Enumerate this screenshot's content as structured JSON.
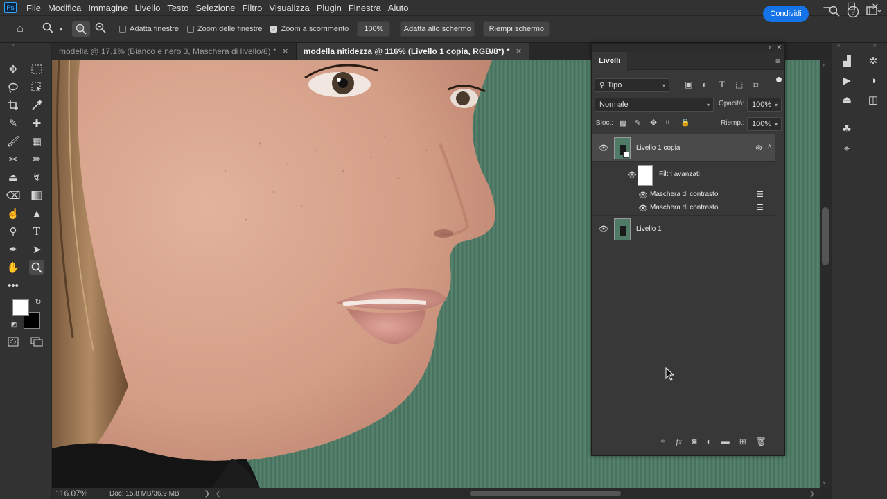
{
  "app": {
    "logo": "Ps"
  },
  "menu": [
    "File",
    "Modifica",
    "Immagine",
    "Livello",
    "Testo",
    "Selezione",
    "Filtro",
    "Visualizza",
    "Plugin",
    "Finestra",
    "Aiuto"
  ],
  "window_controls": {
    "minimize": "—",
    "restore": "❐",
    "close": "✕"
  },
  "options": {
    "fit_windows": "Adatta finestre",
    "zoom_all_windows": "Zoom delle finestre",
    "scrubby_zoom": "Zoom a scorrimento",
    "zoom_value": "100%",
    "fit_screen": "Adatta allo schermo",
    "fill_screen": "Riempi schermo",
    "share": "Condividi"
  },
  "tabs": [
    {
      "label": "modella @ 17,1% (Bianco e nero 3, Maschera di livello/8) *",
      "active": false
    },
    {
      "label": "modella nitidezza @ 116% (Livello 1 copia, RGB/8*) *",
      "active": true
    }
  ],
  "tab_close": "✕",
  "status": {
    "zoom": "116.07%",
    "doc": "Doc: 15,8 MB/36,9 MB",
    "arrow": "❯"
  },
  "layers_panel": {
    "title": "Livelli",
    "filter_kind": "Tipo",
    "blend_mode": "Normale",
    "opacity_label": "Opacità:",
    "opacity_value": "100%",
    "lock_label": "Bloc.:",
    "fill_label": "Riemp.:",
    "fill_value": "100%",
    "layers": [
      {
        "name": "Livello 1 copia",
        "selected": true
      },
      {
        "name": "Filtri avanzati",
        "selected": false
      },
      {
        "name": "Maschera di contrasto",
        "selected": false
      },
      {
        "name": "Maschera di contrasto",
        "selected": false
      },
      {
        "name": "Livello 1",
        "selected": false
      }
    ]
  },
  "colors": {
    "accent": "#1473e6",
    "background_green": "#4f7a66",
    "panel": "#383838"
  }
}
